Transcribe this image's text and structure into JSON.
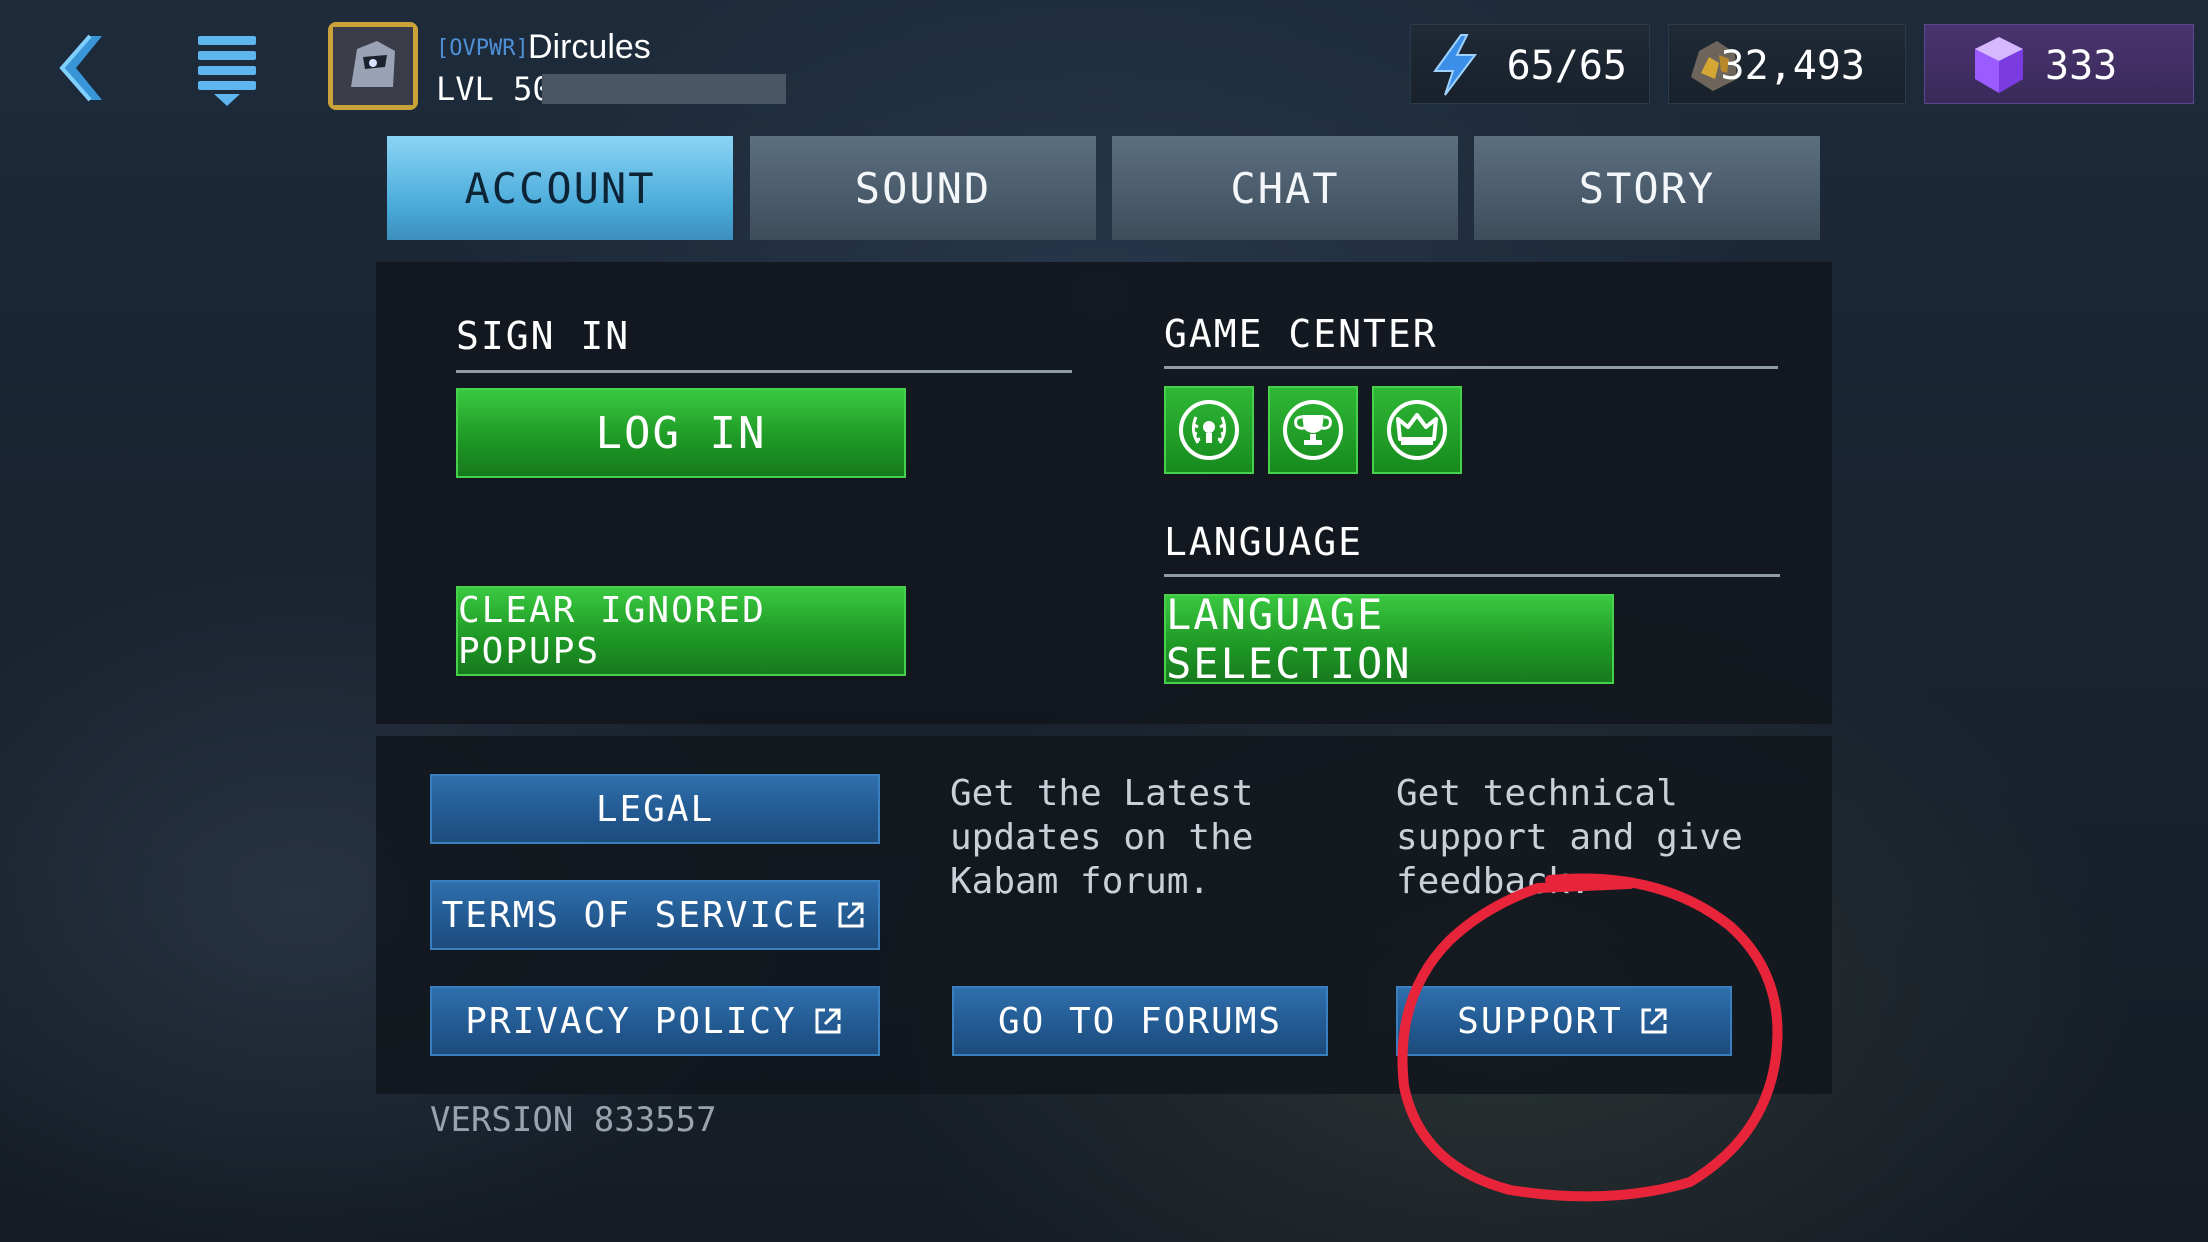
{
  "player": {
    "alliance_tag": "[OVPWR]",
    "name": "Dircules",
    "level": "LVL 50",
    "xp_progress": 0
  },
  "resources": {
    "energy": "65/65",
    "gold": "32,493",
    "units": "333"
  },
  "tabs": [
    {
      "label": "ACCOUNT",
      "active": true
    },
    {
      "label": "SOUND",
      "active": false
    },
    {
      "label": "CHAT",
      "active": false
    },
    {
      "label": "STORY",
      "active": false
    }
  ],
  "sign_in": {
    "title": "SIGN IN",
    "login_label": "LOG IN",
    "clear_popups_label": "CLEAR IGNORED POPUPS"
  },
  "game_center": {
    "title": "GAME CENTER",
    "icons": [
      "laurel-icon",
      "trophy-icon",
      "crown-icon"
    ]
  },
  "language": {
    "title": "LANGUAGE",
    "selection_label": "LANGUAGE SELECTION"
  },
  "links": {
    "legal_label": "LEGAL",
    "terms_label": "TERMS OF SERVICE",
    "privacy_label": "PRIVACY POLICY",
    "forums_text": "Get the Latest\nupdates on the\nKabam forum.",
    "forums_label": "GO TO FORUMS",
    "support_text": "Get technical\nsupport and give\nfeedback.",
    "support_label": "SUPPORT"
  },
  "version": "VERSION 833557",
  "colors": {
    "active_tab": "#48a9d8",
    "green_button": "#1f9a26",
    "blue_button": "#235a92",
    "annotation_circle": "#e8243a",
    "units_panel": "#4a3470"
  }
}
